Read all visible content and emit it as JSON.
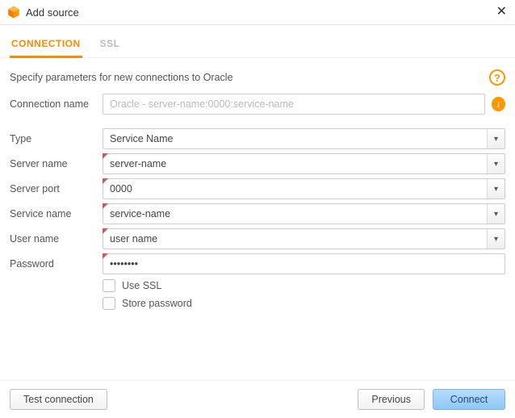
{
  "window": {
    "title": "Add source"
  },
  "tabs": {
    "connection": "CONNECTION",
    "ssl": "SSL"
  },
  "header": {
    "spec": "Specify parameters for new connections to Oracle"
  },
  "fields": {
    "connection_name": {
      "label": "Connection name",
      "placeholder": "Oracle - server-name:0000:service-name",
      "value": ""
    },
    "type": {
      "label": "Type",
      "value": "Service Name"
    },
    "server_name": {
      "label": "Server name",
      "value": "server-name"
    },
    "server_port": {
      "label": "Server port",
      "value": "0000"
    },
    "service_name": {
      "label": "Service name",
      "value": "service-name"
    },
    "user_name": {
      "label": "User name",
      "value": "user name"
    },
    "password": {
      "label": "Password",
      "value": "••••••••"
    },
    "use_ssl": {
      "label": "Use SSL",
      "checked": false
    },
    "store_password": {
      "label": "Store password",
      "checked": false
    }
  },
  "buttons": {
    "test": "Test connection",
    "previous": "Previous",
    "connect": "Connect"
  },
  "icons": {
    "help": "?",
    "info": "i",
    "close": "✕",
    "caret": "▾"
  }
}
